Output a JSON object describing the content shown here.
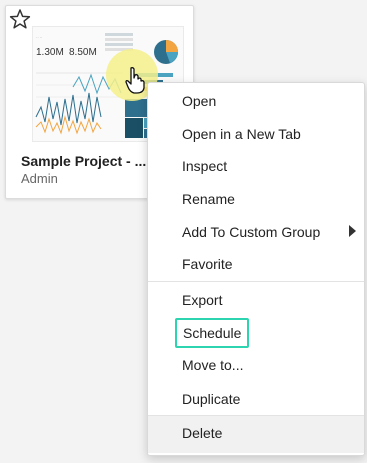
{
  "card": {
    "title": "Sample Project - ...",
    "subtitle": "Admin",
    "thumbnail": {
      "kpi_1": "1.30M",
      "kpi_2": "8.50M"
    }
  },
  "icons": {
    "star": "star-outline-icon",
    "submenu": "caret-right-icon",
    "cursor": "hand-pointer-icon"
  },
  "colors": {
    "highlight_border": "#2dd4b0",
    "cursor_glow": "#f5f08a"
  },
  "menu": {
    "items": [
      {
        "label": "Open"
      },
      {
        "label": "Open in a New Tab"
      },
      {
        "label": "Inspect"
      },
      {
        "label": "Rename"
      },
      {
        "label": "Add To Custom Group"
      },
      {
        "label": "Favorite"
      },
      {
        "label": "Export"
      },
      {
        "label": "Schedule"
      },
      {
        "label": "Move to..."
      },
      {
        "label": "Duplicate"
      },
      {
        "label": "Delete"
      }
    ]
  }
}
